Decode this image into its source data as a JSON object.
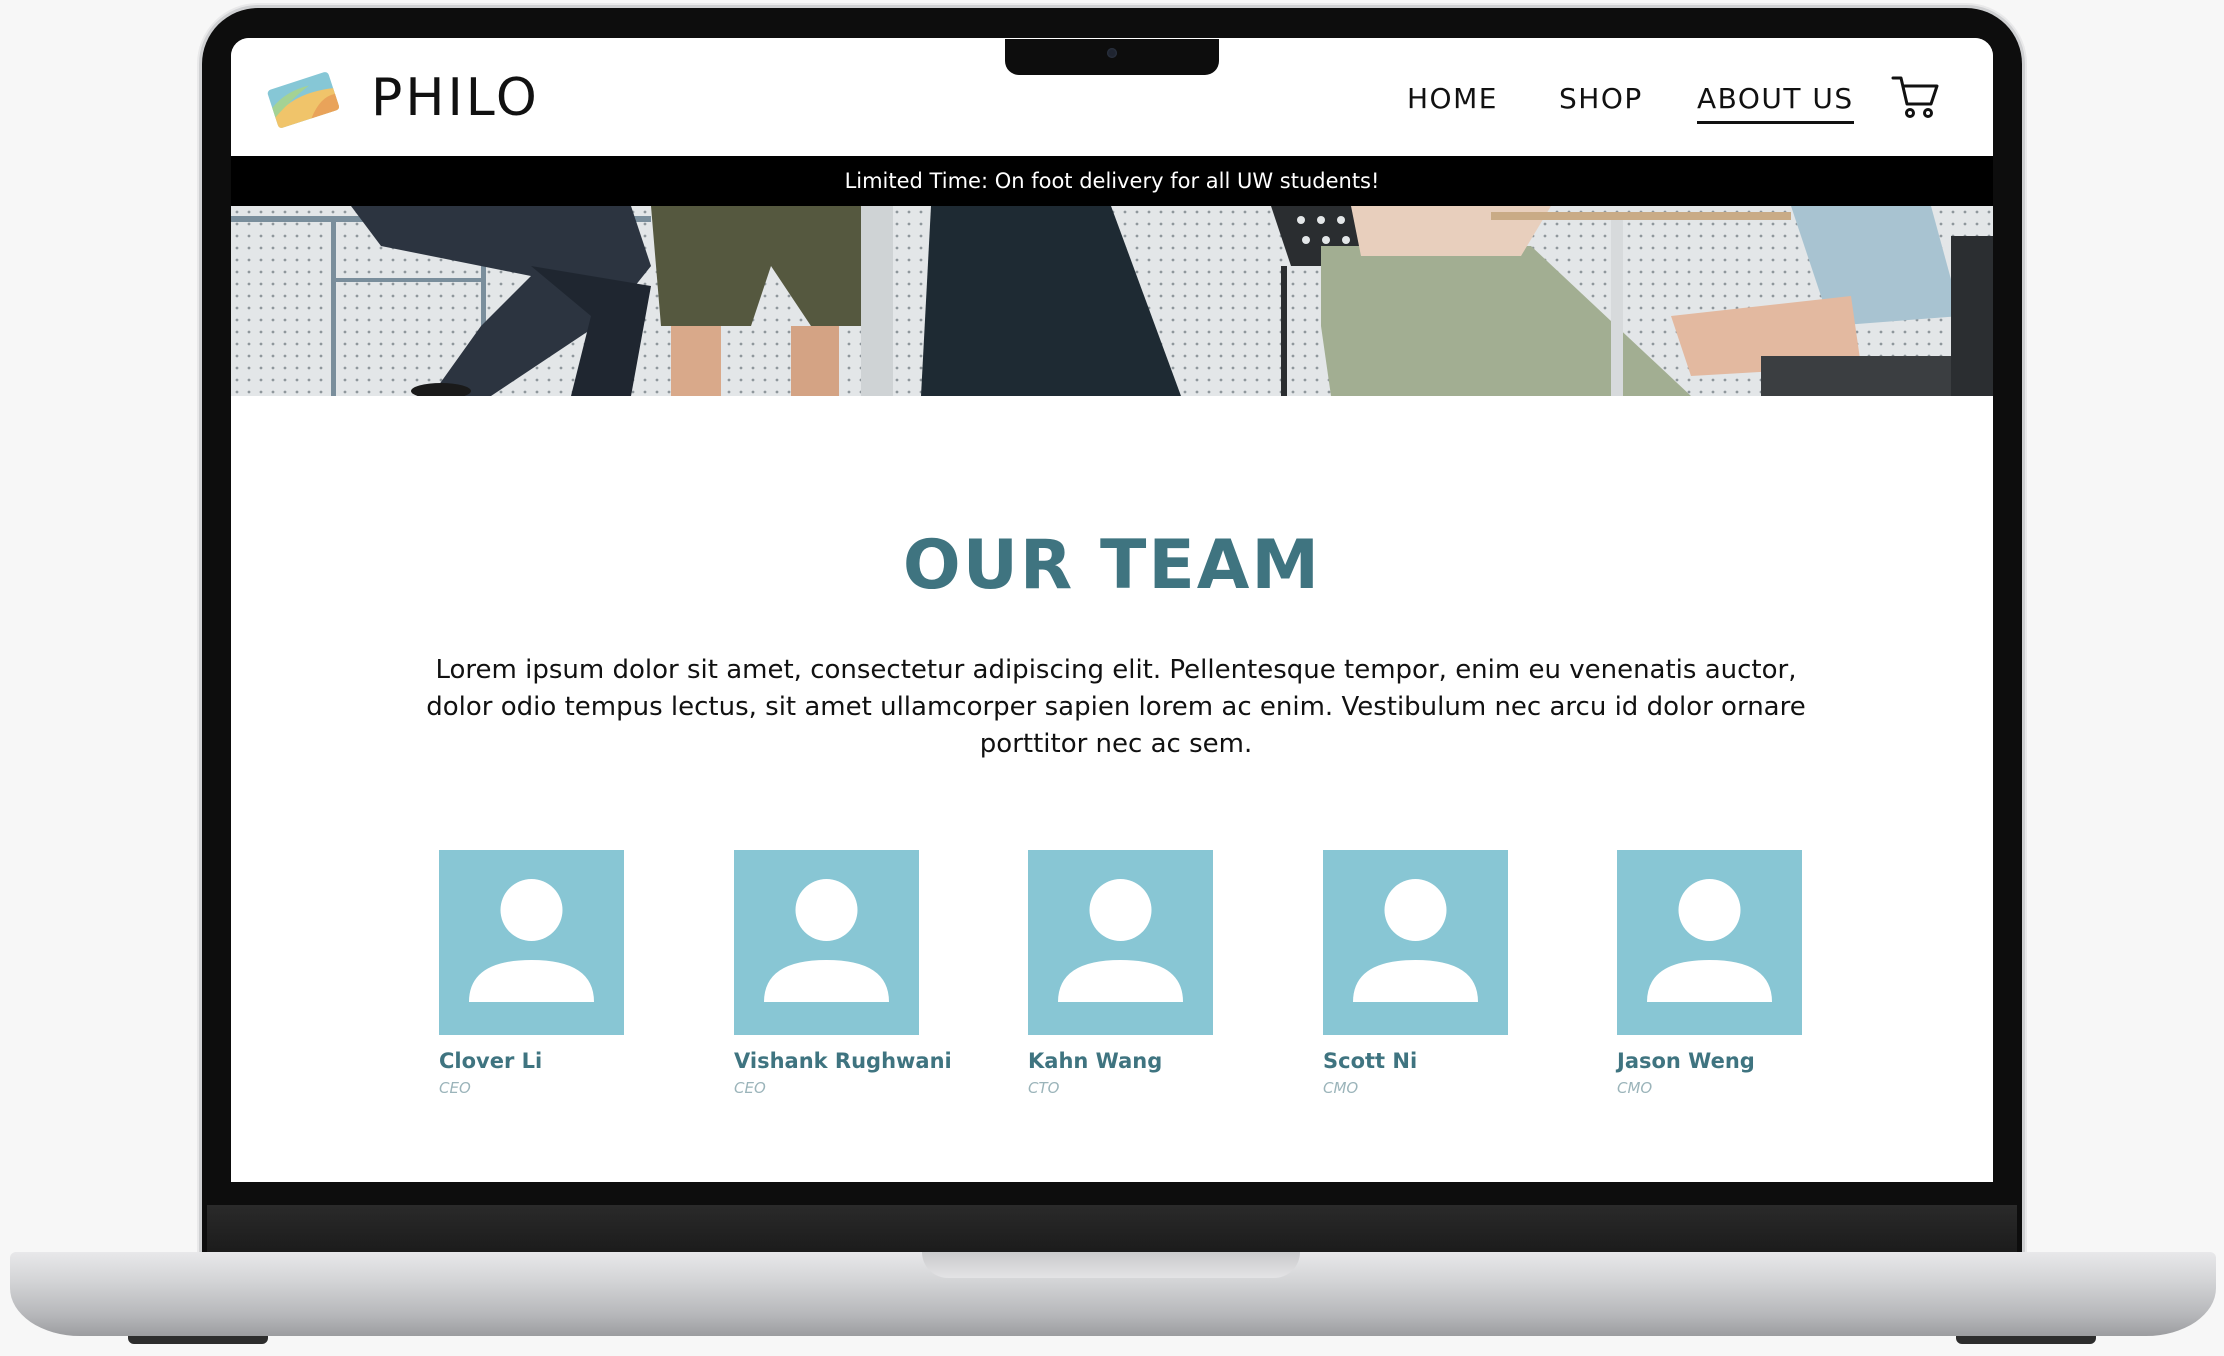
{
  "site": {
    "brand": "PHILO"
  },
  "nav": {
    "items": [
      {
        "label": "HOME",
        "active": false
      },
      {
        "label": "SHOP",
        "active": false
      },
      {
        "label": "ABOUT US",
        "active": true
      }
    ],
    "cart_icon": "shopping-cart-icon"
  },
  "promo": {
    "text": "Limited Time: On foot delivery for all UW students!"
  },
  "team": {
    "title": "OUR TEAM",
    "intro": "Lorem ipsum dolor sit amet, consectetur adipiscing elit. Pellentesque tempor, enim eu venenatis auctor, dolor odio tempus lectus, sit amet ullamcorper sapien lorem ac enim. Vestibulum nec arcu id dolor ornare porttitor nec ac sem.",
    "members": [
      {
        "name": "Clover Li",
        "role": "CEO",
        "avatar_icon": "person-icon"
      },
      {
        "name": "Vishank Rughwani",
        "role": "CEO",
        "avatar_icon": "person-icon"
      },
      {
        "name": "Kahn Wang",
        "role": "CTO",
        "avatar_icon": "person-icon"
      },
      {
        "name": "Scott Ni",
        "role": "CMO",
        "avatar_icon": "person-icon"
      },
      {
        "name": "Jason Weng",
        "role": "CMO",
        "avatar_icon": "person-icon"
      }
    ]
  },
  "colors": {
    "accent": "#3f7480",
    "avatar_bg": "#88c6d4",
    "promo_bg": "#000000",
    "role_text": "#9bb4ba"
  }
}
